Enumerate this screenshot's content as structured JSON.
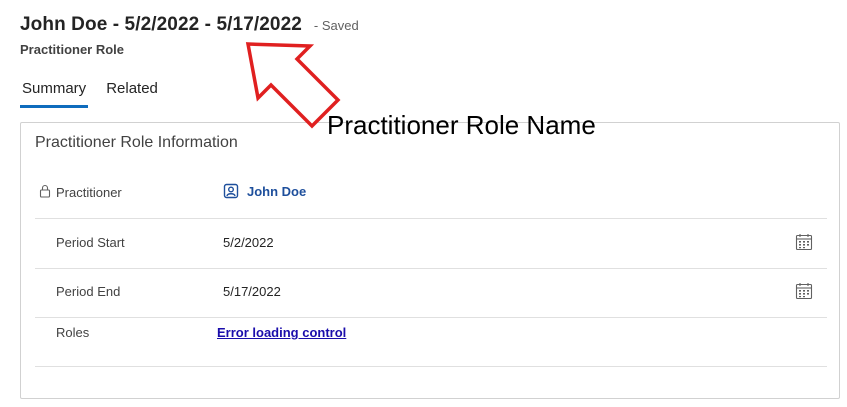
{
  "header": {
    "record_title": "John Doe - 5/2/2022 - 5/17/2022",
    "save_status": "- Saved",
    "entity_name": "Practitioner Role"
  },
  "tabs": [
    {
      "label": "Summary",
      "active": true
    },
    {
      "label": "Related",
      "active": false
    }
  ],
  "section": {
    "title": "Practitioner Role Information",
    "fields": {
      "practitioner": {
        "label": "Practitioner",
        "value": "John Doe",
        "icon": "contact-icon",
        "locked": true
      },
      "period_start": {
        "label": "Period Start",
        "value": "5/2/2022",
        "icon": "calendar-icon"
      },
      "period_end": {
        "label": "Period End",
        "value": "5/17/2022",
        "icon": "calendar-icon"
      },
      "roles": {
        "label": "Roles",
        "value": "Error loading control"
      }
    }
  },
  "annotation": {
    "text": "Practitioner Role Name",
    "color": "#e02020",
    "icon": "arrow-icon"
  },
  "colors": {
    "accent": "#0f6cbd",
    "lookup_link": "#1e4f9c",
    "error_link": "#1a0dab",
    "annotation_arrow": "#e02020"
  }
}
